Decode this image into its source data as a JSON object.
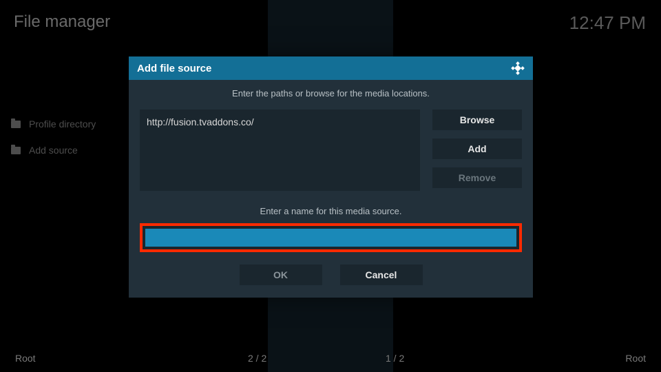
{
  "header": {
    "title": "File manager",
    "clock": "12:47 PM"
  },
  "sidebar": {
    "items": [
      {
        "label": "Profile directory"
      },
      {
        "label": "Add source"
      }
    ]
  },
  "dialog": {
    "title": "Add file source",
    "hint_paths": "Enter the paths or browse for the media locations.",
    "path_value": "http://fusion.tvaddons.co/",
    "browse_label": "Browse",
    "add_label": "Add",
    "remove_label": "Remove",
    "hint_name": "Enter a name for this media source.",
    "name_value": "",
    "ok_label": "OK",
    "cancel_label": "Cancel"
  },
  "footer": {
    "left_root": "Root",
    "left_count": "2 / 2",
    "right_count": "1 / 2",
    "right_root": "Root"
  }
}
